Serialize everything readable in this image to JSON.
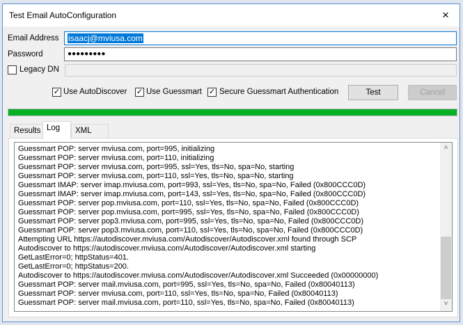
{
  "window": {
    "title": "Test Email AutoConfiguration",
    "close_icon": "×"
  },
  "form": {
    "email_label": "Email Address",
    "email_value": "isaacj@mviusa.com",
    "password_label": "Password",
    "password_value": "●●●●●●●●●",
    "legacy_dn_label": "Legacy DN",
    "legacy_dn_checked": false,
    "legacy_dn_value": ""
  },
  "options": [
    {
      "label": "Use AutoDiscover",
      "checked": true
    },
    {
      "label": "Use Guessmart",
      "checked": true
    },
    {
      "label": "Secure Guessmart Authentication",
      "checked": true
    }
  ],
  "buttons": {
    "test": "Test",
    "cancel": "Cancel"
  },
  "progress": {
    "percent": 100,
    "color": "#06b025"
  },
  "tabs": [
    {
      "label": "Results"
    },
    {
      "label": "Log",
      "active": true
    },
    {
      "label": "XML"
    }
  ],
  "log": [
    "Guessmart POP: server mviusa.com, port=995, initializing",
    "Guessmart POP: server mviusa.com, port=110, initializing",
    "Guessmart POP: server mviusa.com, port=995, ssl=Yes, tls=No, spa=No, starting",
    "Guessmart POP: server mviusa.com, port=110, ssl=Yes, tls=No, spa=No, starting",
    "Guessmart IMAP: server imap.mviusa.com, port=993, ssl=Yes, tls=No, spa=No, Failed (0x800CCC0D)",
    "Guessmart IMAP: server imap.mviusa.com, port=143, ssl=Yes, tls=No, spa=No, Failed (0x800CCC0D)",
    "Guessmart POP: server pop.mviusa.com, port=110, ssl=Yes, tls=No, spa=No, Failed (0x800CCC0D)",
    "Guessmart POP: server pop.mviusa.com, port=995, ssl=Yes, tls=No, spa=No, Failed (0x800CCC0D)",
    "Guessmart POP: server pop3.mviusa.com, port=995, ssl=Yes, tls=No, spa=No, Failed (0x800CCC0D)",
    "Guessmart POP: server pop3.mviusa.com, port=110, ssl=Yes, tls=No, spa=No, Failed (0x800CCC0D)",
    "Attempting URL https://autodiscover.mviusa.com/Autodiscover/Autodiscover.xml found through SCP",
    "Autodiscover to https://autodiscover.mviusa.com/Autodiscover/Autodiscover.xml starting",
    "GetLastError=0; httpStatus=401.",
    "GetLastError=0; httpStatus=200.",
    "Autodiscover to https://autodiscover.mviusa.com/Autodiscover/Autodiscover.xml Succeeded (0x00000000)",
    "Guessmart POP: server mail.mviusa.com, port=995, ssl=Yes, tls=No, spa=No, Failed (0x80040113)",
    "Guessmart POP: server mviusa.com, port=110, ssl=Yes, tls=No, spa=No, Failed (0x80040113)",
    "Guessmart POP: server mail.mviusa.com, port=110, ssl=Yes, tls=No, spa=No, Failed (0x80040113)"
  ],
  "scrollbar": {
    "up": "˄",
    "down": "˅"
  }
}
